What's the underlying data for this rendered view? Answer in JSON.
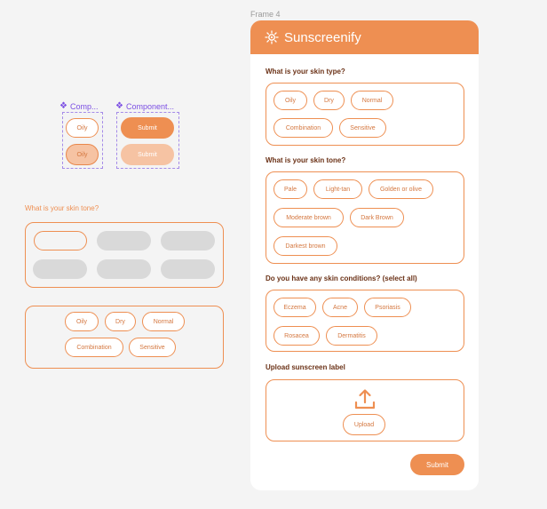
{
  "canvas": {
    "frame_label": "Frame 4"
  },
  "components": {
    "set1_label": "Comp...",
    "set2_label": "Component...",
    "oily_default": "Oily",
    "oily_selected": "Oily",
    "submit_default": "Submit",
    "submit_disabled": "Submit"
  },
  "left_panel": {
    "skin_tone_label": "What is your skin tone?",
    "skin_type_options": [
      "Oily",
      "Dry",
      "Normal",
      "Combination",
      "Sensitive"
    ]
  },
  "app": {
    "title": "Sunscreenify",
    "skin_type": {
      "question": "What is your skin type?",
      "options": [
        "Oily",
        "Dry",
        "Normal",
        "Combination",
        "Sensitive"
      ]
    },
    "skin_tone": {
      "question": "What is your skin tone?",
      "options": [
        "Pale",
        "Light-tan",
        "Golden or olive",
        "Moderate brown",
        "Dark Brown",
        "Darkest brown"
      ]
    },
    "conditions": {
      "question": "Do you have any skin conditions? (select all)",
      "options": [
        "Eczema",
        "Acne",
        "Psoriasis",
        "Rosacea",
        "Dermatitis"
      ]
    },
    "upload": {
      "question": "Upload sunscreen label",
      "button": "Upload"
    },
    "submit": "Submit"
  },
  "colors": {
    "accent": "#ee8f52",
    "accent_light": "#f6c3a3",
    "component_purple": "#7b4ee3"
  },
  "icons": [
    "component-diamond-icon",
    "sun-logo-icon",
    "upload-icon"
  ]
}
